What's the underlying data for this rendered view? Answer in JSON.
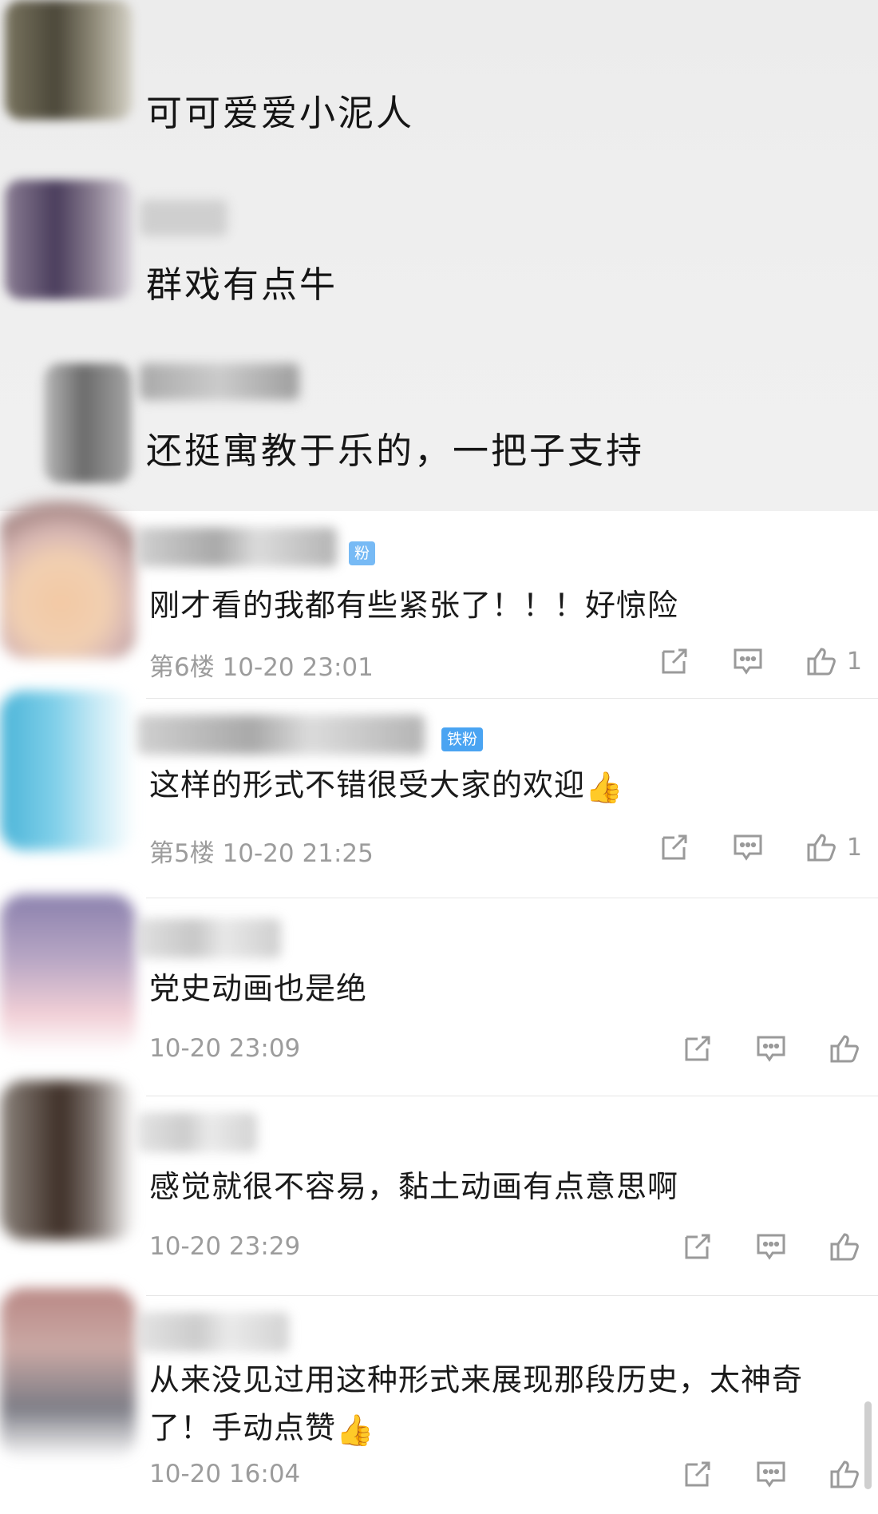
{
  "screenshot_comments": [
    {
      "text": "可可爱爱小泥人"
    },
    {
      "text": "群戏有点牛"
    },
    {
      "text": "还挺寓教于乐的，一把子支持"
    }
  ],
  "comments": [
    {
      "badge": "粉",
      "text": "刚才看的我都有些紧张了！！！好惊险",
      "meta": "第6楼 10-20 23:01",
      "likes": "1"
    },
    {
      "badge": "铁粉",
      "text": "这样的形式不错很受大家的欢迎",
      "emoji": "👍",
      "meta": "第5楼 10-20 21:25",
      "likes": "1"
    },
    {
      "text": "党史动画也是绝",
      "meta": "10-20 23:09"
    },
    {
      "text": "感觉就很不容易，黏土动画有点意思啊",
      "meta": "10-20 23:29"
    },
    {
      "text": "从来没见过用这种形式来展现那段历史，太神奇了！手动点赞",
      "emoji": "👍",
      "meta": "10-20 16:04"
    }
  ],
  "icons": {
    "share": "share-icon",
    "reply": "comment-icon",
    "like": "thumb-up-icon"
  }
}
